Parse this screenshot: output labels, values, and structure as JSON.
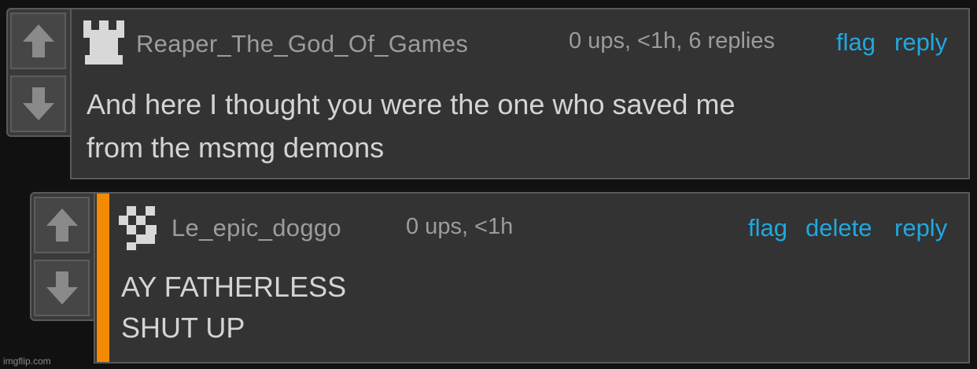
{
  "comments": [
    {
      "username": "Reaper_The_God_Of_Games",
      "meta": "0 ups, <1h, 6 replies",
      "actions": [
        "flag",
        "reply"
      ],
      "body": [
        "And here I thought you were the one who saved me",
        "from the msmg demons"
      ],
      "avatar_icon": "rook-icon"
    },
    {
      "username": "Le_epic_doggo",
      "meta": "0 ups, <1h",
      "actions": [
        "flag",
        "delete",
        "reply"
      ],
      "body": [
        "AY FATHERLESS",
        "SHUT UP"
      ],
      "avatar_icon": "pixel-pattern-icon",
      "accent_color": "#f28a06"
    }
  ],
  "watermark": "imgflip.com",
  "colors": {
    "background": "#111111",
    "panel": "#333333",
    "link": "#1fa8e0",
    "text": "#d4d4d4",
    "muted": "#9c9c9c"
  }
}
